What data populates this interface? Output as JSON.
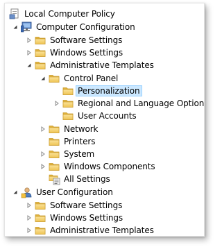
{
  "tree": {
    "root": {
      "label": "Local Computer Policy",
      "icon": "policy-document-icon"
    },
    "computer_configuration": {
      "label": "Computer Configuration",
      "icon": "computer-icon",
      "software_settings": "Software Settings",
      "windows_settings": "Windows Settings",
      "administrative_templates": "Administrative Templates",
      "control_panel": "Control Panel",
      "personalization": "Personalization",
      "regional_and_language_options": "Regional and Language Options",
      "user_accounts": "User Accounts",
      "network": "Network",
      "printers": "Printers",
      "system": "System",
      "windows_components": "Windows Components",
      "all_settings": "All Settings"
    },
    "user_configuration": {
      "label": "User Configuration",
      "icon": "user-icon",
      "software_settings": "Software Settings",
      "windows_settings": "Windows Settings",
      "administrative_templates": "Administrative Templates"
    },
    "selected_item": "Personalization"
  },
  "colors": {
    "selection_fill": "#cce8ff",
    "selection_border": "#99d1ff",
    "folder": "#f5c94a"
  }
}
